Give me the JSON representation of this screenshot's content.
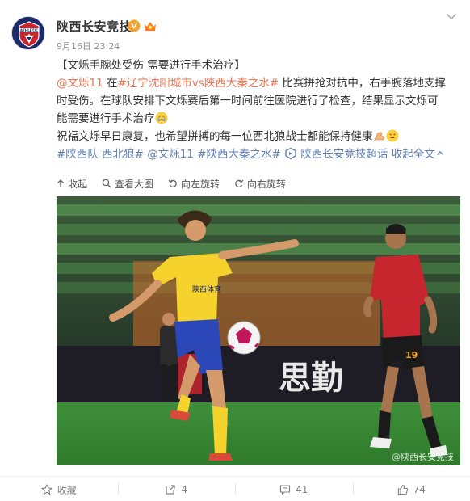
{
  "account": {
    "name": "陕西长安竞技",
    "time": "9月16日 23:24",
    "avatar_text": "ATHLETIC"
  },
  "post": {
    "title": "【文烁手腕处受伤 需要进行手术治疗】",
    "mention_1": "@文烁11",
    "text_1": " 在",
    "tag_1": "#辽宁沈阳城市vs陕西大秦之水#",
    "text_2": " 比赛拼抢对抗中，右手腕落地支撑",
    "line_3": "时受伤。在球队安排下文烁赛后第一时间前往医院进行了检查，结果显示文烁可",
    "line_4": "能需要进行手术治疗",
    "line_5": "祝福文烁早日康复，也希望拼搏的每一位西北狼战士都能保持健康",
    "tag_2": "#陕西队 西北狼#",
    "mention_2": "@文烁11",
    "tag_3": "#陕西大秦之水#",
    "super_topic": "陕西长安竞技超话",
    "collapse": "收起全文"
  },
  "toolbar": {
    "collect": "收起",
    "view_large": "查看大图",
    "rotate_left": "向左旋转",
    "rotate_right": "向右旋转"
  },
  "photo": {
    "ad_board": "思勤",
    "jersey_number": "19",
    "chest_text": "陕西体育",
    "watermark": "@陕西长安竞技"
  },
  "actions": {
    "favorite": "收藏",
    "repost": "4",
    "comment": "41",
    "like": "74"
  },
  "colors": {
    "link": "#eb7350",
    "tag": "#5d7fb5",
    "verified": "#f7a12b",
    "pitch": "#3f8f3a",
    "home_kit": "#f5d22c",
    "away_kit": "#c8262e"
  },
  "icons": [
    "more-icon",
    "verified-icon",
    "vip-badge-icon",
    "crying-emoji-icon",
    "muscle-emoji-icon",
    "smile-emoji-icon",
    "super-topic-icon",
    "collapse-icon",
    "zoom-icon",
    "rotate-left-icon",
    "rotate-right-icon",
    "star-icon",
    "repost-icon",
    "comment-icon",
    "thumb-up-icon"
  ]
}
